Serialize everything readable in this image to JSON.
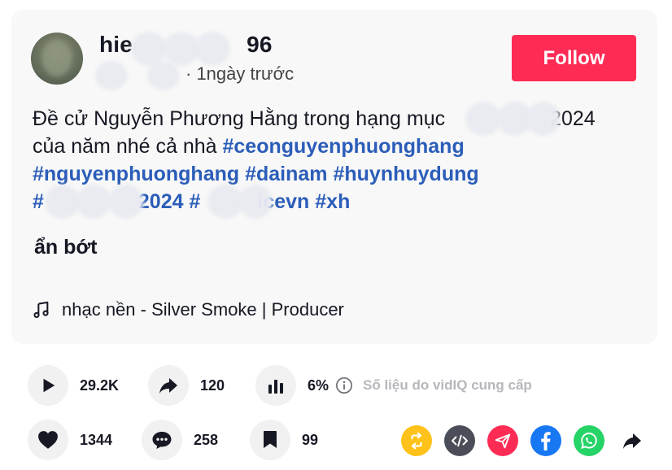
{
  "post": {
    "username_visible": "hie96",
    "username_parts": [
      "hie",
      "96"
    ],
    "meta_time": "· 1ngày trước",
    "follow_label": "Follow",
    "caption_line1_text": "Đề cử Nguyễn Phương Hằng trong hạng mục ",
    "caption_line1_year": "2024",
    "caption_line2_text": "của năm nhé cả nhà ",
    "hashtags": {
      "ceo": "#ceonguyenphuonghang",
      "nguyen": "#nguyenphuonghang",
      "dainam": "#dainam",
      "huynh": "#huynhuydung",
      "year_tag_prefix": "#",
      "year_tag_suffix": "2024",
      "vn_tag_prefix": "#",
      "vn_tag_suffix": "icevn",
      "xh": "#xh"
    },
    "show_less_label": "ẩn bớt",
    "music": "nhạc nền - Silver Smoke | Producer"
  },
  "stats": {
    "plays": "29.2K",
    "shares": "120",
    "engagement": "6%",
    "vidiq_note": "Số liệu do vidIQ cung cấp",
    "likes": "1344",
    "comments": "258",
    "saves": "99"
  },
  "icons": {
    "play": "play-icon",
    "share": "share-arrow-icon",
    "chart": "bar-chart-icon",
    "info": "info-icon",
    "heart": "heart-icon",
    "comment": "comment-icon",
    "bookmark": "bookmark-icon",
    "repost": "repost-icon",
    "embed": "embed-icon",
    "send": "send-icon",
    "facebook": "facebook-icon",
    "whatsapp": "whatsapp-icon",
    "more_share": "more-share-icon"
  },
  "colors": {
    "follow": "#fe2c55",
    "hashtag": "#2b5db9",
    "repost": "#ffc21a",
    "embed": "#4b4e58",
    "send": "#fe2c55",
    "facebook": "#1877f2",
    "whatsapp": "#25d366"
  }
}
